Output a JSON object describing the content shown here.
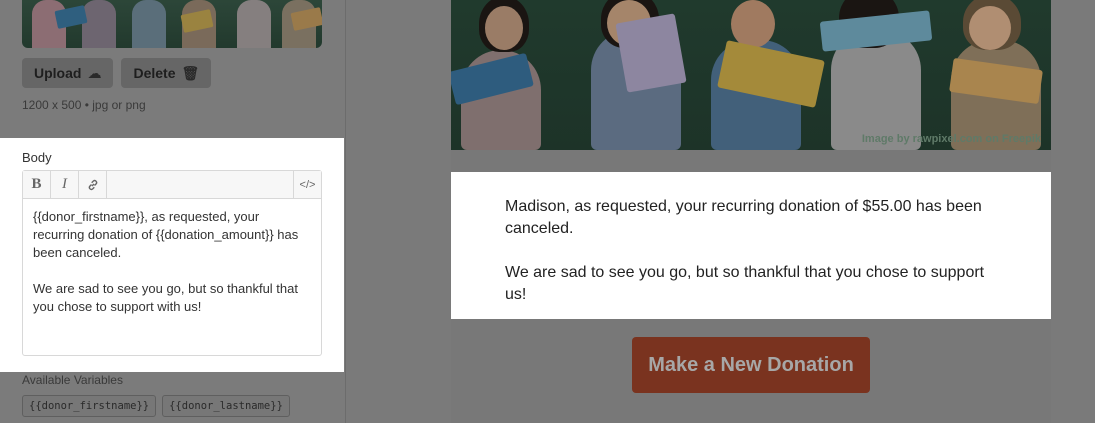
{
  "image_panel": {
    "upload_label": "Upload",
    "upload_icon": "cloud-upload-icon",
    "delete_label": "Delete",
    "delete_icon": "trash-icon",
    "hint": "1200 x 500  •  jpg or png"
  },
  "body_editor": {
    "label": "Body",
    "toolbar": {
      "bold": "B",
      "italic": "I",
      "link_icon": "link-icon",
      "code": "</>"
    },
    "paragraphs": [
      "{{donor_firstname}}, as requested, your recurring donation of {{donation_amount}} has been canceled.",
      "We are sad to see you go, but so thankful that you chose to support with us!"
    ]
  },
  "variables": {
    "label": "Available Variables",
    "chips": [
      "{{donor_firstname}}",
      "{{donor_lastname}}"
    ]
  },
  "preview": {
    "image_credit": "Image by rawpixel.com on Freepik",
    "paragraphs": [
      "Madison, as requested, your recurring donation of $55.00 has been canceled.",
      "We are sad to see you go, but so thankful that you chose to support us!"
    ],
    "button_label": "Make a New Donation"
  },
  "colors": {
    "overlay": "#7a7a7a",
    "button": "#7a331f"
  }
}
